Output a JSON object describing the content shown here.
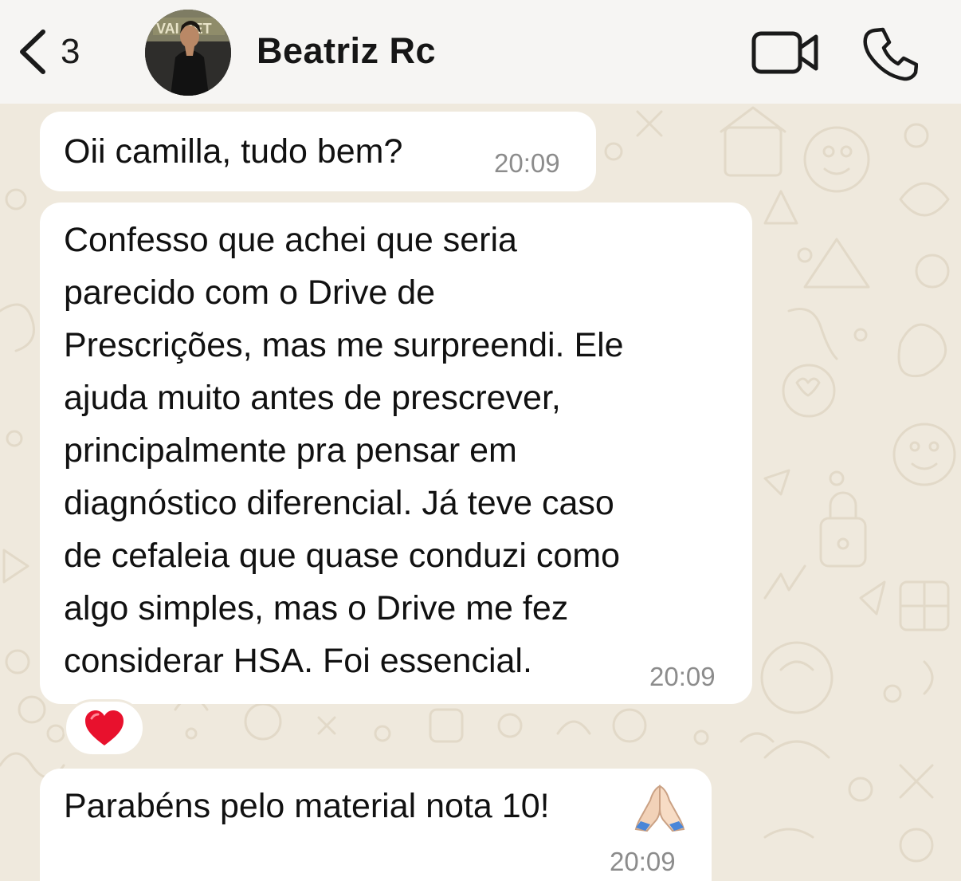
{
  "header": {
    "back_count": "3",
    "contact_name": "Beatriz Rc",
    "icons": {
      "back": "chevron-left-icon",
      "video": "video-camera-icon",
      "call": "phone-icon"
    }
  },
  "messages": [
    {
      "lines": [
        "Oii camilla, tudo bem?"
      ],
      "time": "20:09"
    },
    {
      "lines": [
        "Confesso que achei que seria",
        "parecido com o Drive de",
        "Prescrições, mas me surpreendi. Ele",
        "ajuda muito antes de prescrever,",
        "principalmente pra pensar em",
        "diagnóstico diferencial. Já teve caso",
        "de cefaleia que quase conduzi como",
        "algo simples, mas o Drive me fez",
        "considerar HSA. Foi essencial."
      ],
      "time": "20:09",
      "reaction": "heart-emoji"
    },
    {
      "lines": [
        "Parabéns pelo material nota 10!"
      ],
      "emoji": "folded-hands-emoji",
      "time": "20:09"
    }
  ],
  "colors": {
    "wallpaper": "#efe9dd",
    "bubble": "#ffffff",
    "timestamp": "#8c8c8c",
    "heart": "#e8112d"
  }
}
